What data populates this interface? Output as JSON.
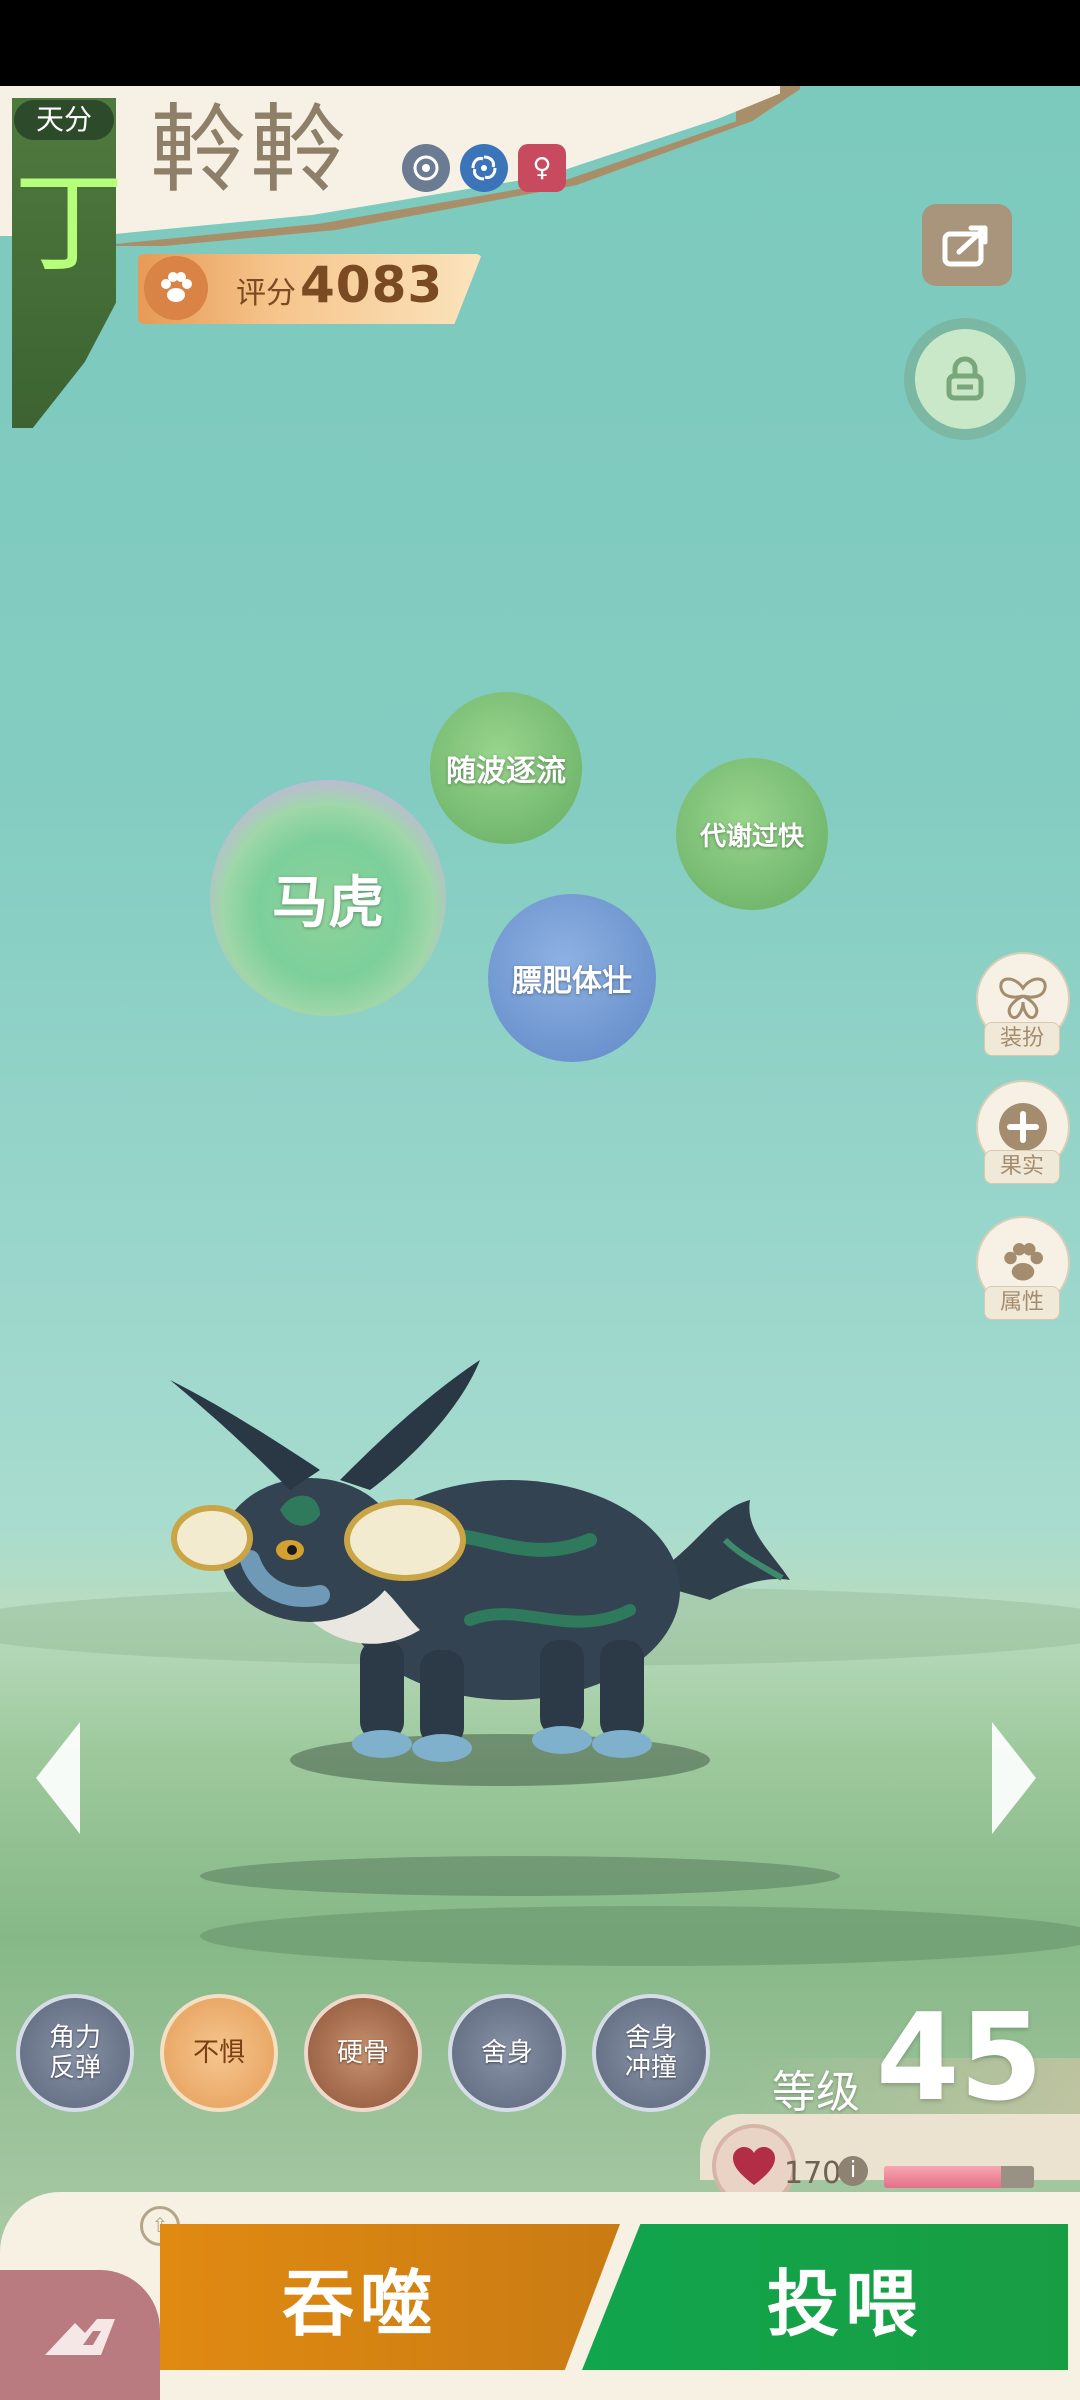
{
  "header": {
    "tier_label": "天分",
    "tier_grade": "丁",
    "pet_name": "軨軨",
    "attribute_icons": [
      "water-element-icon",
      "wind-element-icon",
      "female-gender-icon"
    ],
    "gender_symbol": "♀",
    "score_label": "评分",
    "score_value": "4083"
  },
  "traits": {
    "main": "马虎",
    "trait1": "随波逐流",
    "trait2": "代谢过快",
    "trait3": "膘肥体壮"
  },
  "side_menu": {
    "outfit": "装扮",
    "fruit": "果实",
    "attributes": "属性"
  },
  "skills": [
    {
      "label": "角力\n反弹"
    },
    {
      "label": "不惧"
    },
    {
      "label": "硬骨"
    },
    {
      "label": "舍身"
    },
    {
      "label": "舍身\n冲撞"
    }
  ],
  "level": {
    "label": "等级",
    "value": "45"
  },
  "hp": {
    "value": "170",
    "info_symbol": "i",
    "fill_fraction": 0.78
  },
  "actions": {
    "devour": "吞噬",
    "feed": "投喂"
  },
  "colors": {
    "tier_grade": "#b6ff7a",
    "devour_button": "#e08a12",
    "feed_button": "#11a54d",
    "sky": "#7cc9bd"
  }
}
